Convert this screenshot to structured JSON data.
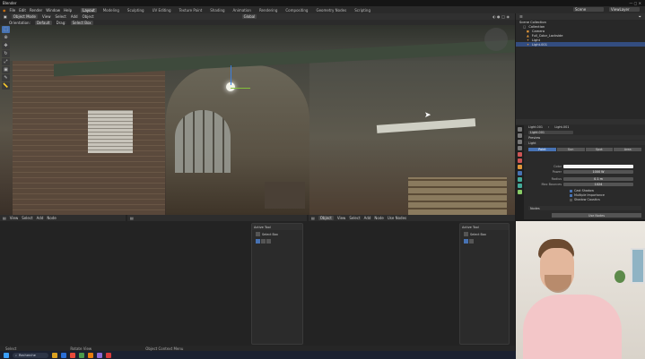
{
  "window": {
    "title": "Blender"
  },
  "menu": {
    "items": [
      "File",
      "Edit",
      "Render",
      "Window",
      "Help"
    ]
  },
  "workspaces": [
    "Layout",
    "Modeling",
    "Sculpting",
    "UV Editing",
    "Texture Paint",
    "Shading",
    "Animation",
    "Rendering",
    "Compositing",
    "Geometry Nodes",
    "Scripting"
  ],
  "active_workspace": "Layout",
  "topright": {
    "scene": "Scene",
    "view_layer": "ViewLayer"
  },
  "viewport": {
    "mode": "Object Mode",
    "menu": [
      "View",
      "Select",
      "Add",
      "Object"
    ],
    "orientation": "Global",
    "header2": [
      "Orientation:",
      "Default",
      "Drag:",
      "Select Box"
    ]
  },
  "lower": {
    "left_menu": [
      "View",
      "Select",
      "Add",
      "Node"
    ],
    "mid_menu": [
      "Object",
      "View",
      "Select",
      "Add",
      "Node",
      "Use Nodes"
    ],
    "panel_title": "Active Tool",
    "panel_item": "Select Box"
  },
  "outliner": {
    "title": "Scene Collection",
    "rows": [
      {
        "label": "Collection",
        "selected": false
      },
      {
        "label": "Camera",
        "selected": false
      },
      {
        "label": "Full_Color_Lockside",
        "selected": false
      },
      {
        "label": "Light",
        "selected": false
      },
      {
        "label": "Light.001",
        "selected": true
      }
    ]
  },
  "properties": {
    "breadcrumb": [
      "Light.001",
      "Light.001"
    ],
    "datablock": "Light.001",
    "sections": [
      "Preview",
      "Light"
    ],
    "light_types": [
      "Point",
      "Sun",
      "Spot",
      "Area"
    ],
    "rows": [
      {
        "label": "Color",
        "value": ""
      },
      {
        "label": "Power",
        "value": "1000 W"
      },
      {
        "label": "Radius",
        "value": "0.1 m"
      },
      {
        "label": "Max Bounces",
        "value": "1024"
      }
    ],
    "checks": [
      "Cast Shadow",
      "Multiple Importance",
      "Shadow Caustics"
    ],
    "footer": [
      "Nodes",
      "Use Nodes"
    ]
  },
  "statusbar": [
    "Select",
    "Rotate View",
    "Object Context Menu"
  ],
  "taskbar": {
    "search": "Recherche"
  },
  "colors": {
    "accent": "#4772b3",
    "selected_row": "#334d80",
    "bg": "#1d1d1d"
  }
}
